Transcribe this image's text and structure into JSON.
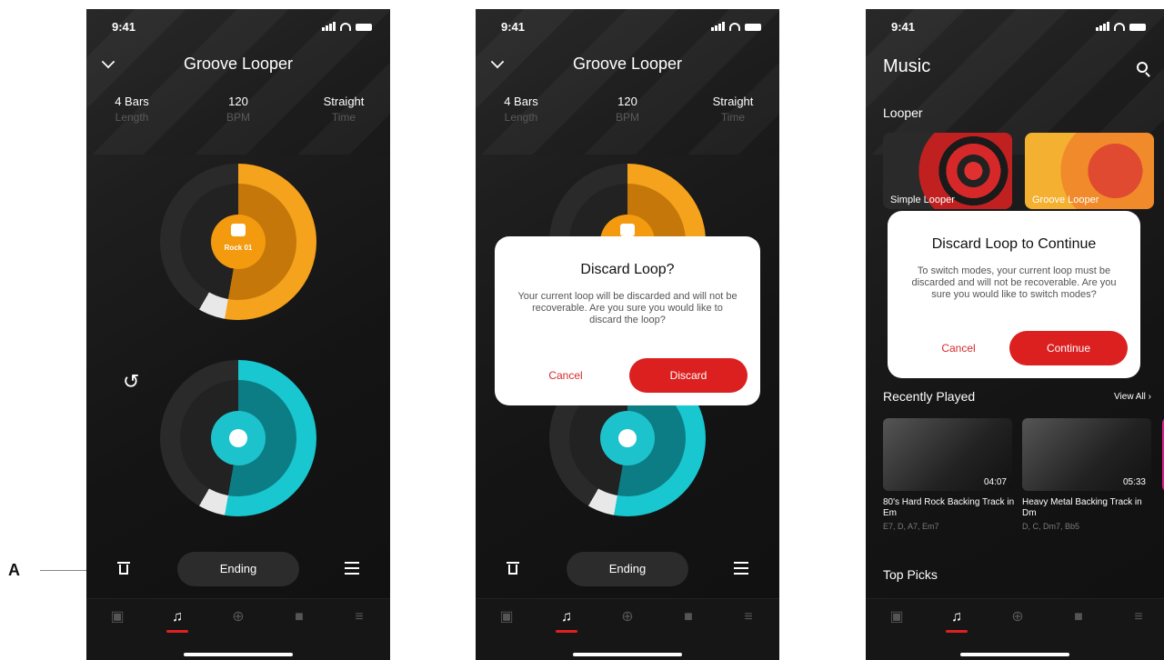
{
  "annotation": {
    "label": "A"
  },
  "screen1": {
    "time": "9:41",
    "title": "Groove Looper",
    "stats": [
      {
        "value": "4 Bars",
        "label": "Length"
      },
      {
        "value": "120",
        "label": "BPM"
      },
      {
        "value": "Straight",
        "label": "Time"
      }
    ],
    "track_label": "Rock 01",
    "ending_label": "Ending"
  },
  "screen2": {
    "time": "9:41",
    "title": "Groove Looper",
    "stats": [
      {
        "value": "4 Bars",
        "label": "Length"
      },
      {
        "value": "120",
        "label": "BPM"
      },
      {
        "value": "Straight",
        "label": "Time"
      }
    ],
    "ending_label": "Ending",
    "dialog": {
      "title": "Discard Loop?",
      "body": "Your current loop will be discarded and will not be recoverable. Are you sure you would like to discard the loop?",
      "cancel": "Cancel",
      "confirm": "Discard"
    }
  },
  "screen3": {
    "time": "9:41",
    "title": "Music",
    "looper_section": "Looper",
    "cards": [
      "Simple Looper",
      "Groove Looper"
    ],
    "recently_played": "Recently Played",
    "view_all": "View All",
    "tracks": [
      {
        "title": "80's Hard Rock Backing Track in Em",
        "chords": "E7, D, A7, Em7",
        "duration": "04:07"
      },
      {
        "title": "Heavy Metal Backing Track in Dm",
        "chords": "D, C, Dm7, Bb5",
        "duration": "05:33"
      }
    ],
    "top_picks": "Top Picks",
    "dialog": {
      "title": "Discard Loop to Continue",
      "body": "To switch modes, your current loop must be discarded and will not be recoverable. Are you sure you would like to switch modes?",
      "cancel": "Cancel",
      "confirm": "Continue"
    }
  },
  "colors": {
    "accent_red": "#dc2020",
    "orange": "#f5a21c",
    "cyan": "#18c7cf"
  },
  "tab_icons": [
    "store-icon",
    "music-note-icon",
    "plus-circle-icon",
    "video-icon",
    "menu-icon"
  ]
}
